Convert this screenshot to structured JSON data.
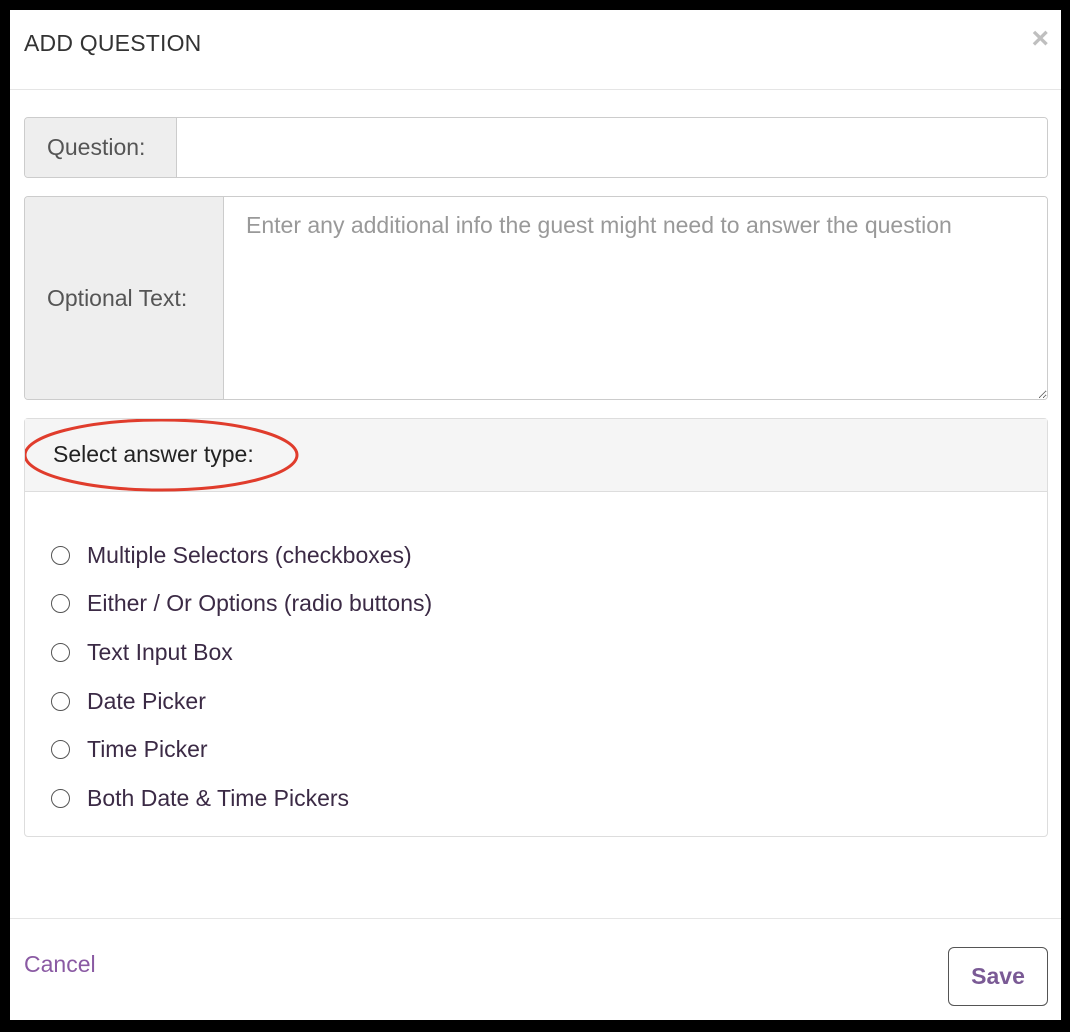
{
  "modal": {
    "title": "ADD QUESTION",
    "close_symbol": "×"
  },
  "question": {
    "label": "Question:",
    "value": ""
  },
  "optional_text": {
    "label": "Optional Text:",
    "placeholder": "Enter any additional info the guest might need to answer the question",
    "value": ""
  },
  "answer_type": {
    "heading": "Select answer type:",
    "annotation_color": "#e03c2c",
    "options": [
      {
        "label": "Multiple Selectors (checkboxes)",
        "selected": false
      },
      {
        "label": "Either / Or Options (radio buttons)",
        "selected": false
      },
      {
        "label": "Text Input Box",
        "selected": false
      },
      {
        "label": "Date Picker",
        "selected": false
      },
      {
        "label": "Time Picker",
        "selected": false
      },
      {
        "label": "Both Date & Time Pickers",
        "selected": false
      }
    ]
  },
  "footer": {
    "cancel_label": "Cancel",
    "save_label": "Save"
  },
  "colors": {
    "accent": "#8a5aa3",
    "annotation": "#e03c2c"
  }
}
